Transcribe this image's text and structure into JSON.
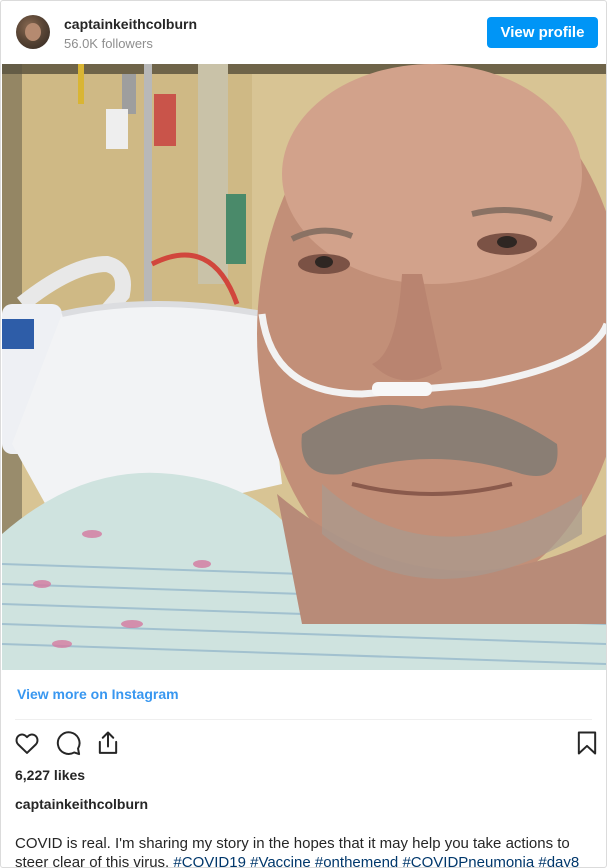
{
  "header": {
    "username": "captainkeithcolburn",
    "followers": "56.0K followers",
    "view_profile_label": "View profile"
  },
  "post": {
    "view_more_label": "View more on Instagram",
    "likes": "6,227 likes",
    "caption_user": "captainkeithcolburn",
    "caption_text": "COVID is real. I'm sharing my story in the hopes that it may help you take actions to steer clear of this virus. ",
    "hashtags": [
      "#COVID19",
      "#Vaccine",
      "#onthemend",
      "#COVIDPneumonia",
      "#day8"
    ]
  },
  "icons": {
    "like": "heart-icon",
    "comment": "comment-icon",
    "share": "share-icon",
    "save": "bookmark-icon"
  },
  "colors": {
    "button": "#0095f6",
    "link": "#3897f0",
    "hashtag": "#00376b"
  }
}
